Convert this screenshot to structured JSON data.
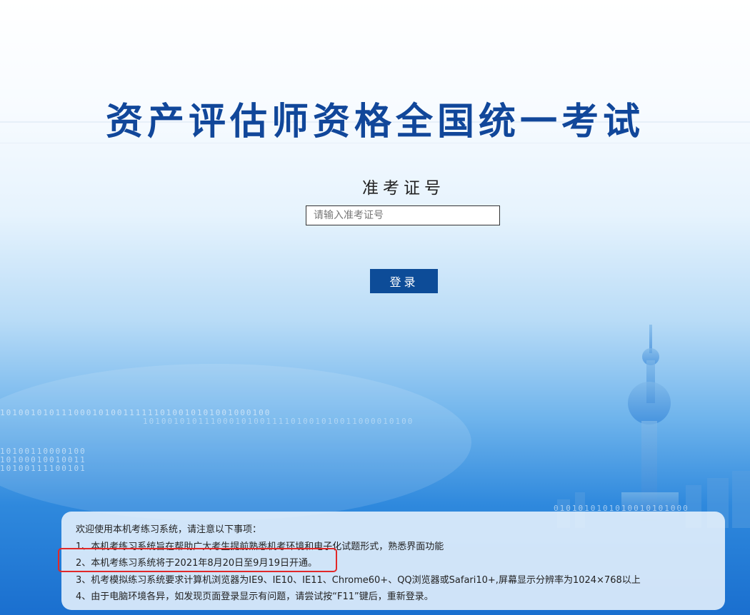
{
  "page": {
    "title": "资产评估师资格全国统一考试"
  },
  "login": {
    "label": "准考证号",
    "placeholder": "请输入准考证号",
    "button_label": "登录"
  },
  "notice": {
    "heading": "欢迎使用本机考练习系统，请注意以下事项：",
    "items": [
      "1、本机考练习系统旨在帮助广大考生提前熟悉机考环境和电子化试题形式，熟悉界面功能",
      "2、本机考练习系统将于2021年8月20日至9月19日开通。",
      "3、机考模拟练习系统要求计算机浏览器为IE9、IE10、IE11、Chrome60+、QQ浏览器或Safari10+,屏幕显示分辨率为1024×768以上",
      "4、由于电脑环境各异，如发现页面登录显示有问题，请尝试按“F11”键后，重新登录。"
    ]
  },
  "background": {
    "binary_lines": [
      "10100101011100010100111111010010101001000100",
      "10100101011100010100111101001010011000010100",
      "10100110000100",
      "10100010010011",
      "10100111100101",
      "0101010101010010101000"
    ]
  },
  "colors": {
    "title": "#11479a",
    "button": "#0d4c98",
    "highlight_border": "#e22828"
  }
}
